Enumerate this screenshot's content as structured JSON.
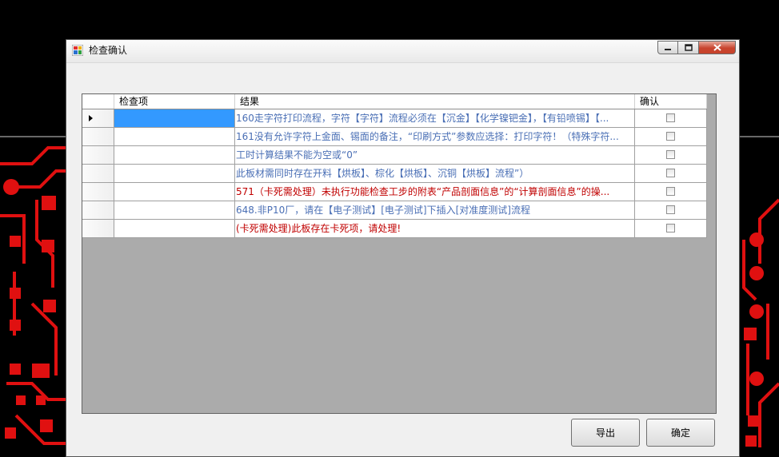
{
  "window": {
    "title": "检查确认",
    "controls": {
      "minimize": "minimize",
      "maximize": "maximize",
      "close": "close"
    }
  },
  "grid": {
    "columns": [
      "检查项",
      "结果",
      "确认"
    ],
    "rows": [
      {
        "item": "",
        "result": "160走字符打印流程，字符【字符】流程必须在【沉金】【化学镍钯金】，【有铅喷锡】【...",
        "confirmed": false,
        "selected": true,
        "color": "#4a6fb5"
      },
      {
        "item": "",
        "result": "161没有允许字符上金面、锡面的备注，“印刷方式”参数应选择：打印字符！（特殊字符...",
        "confirmed": false,
        "selected": false,
        "color": "#4a6fb5"
      },
      {
        "item": "",
        "result": "工时计算结果不能为空或“0”",
        "confirmed": false,
        "selected": false,
        "color": "#4a6fb5"
      },
      {
        "item": "",
        "result": "此板材需同时存在开料【烘板】、棕化【烘板】、沉铜【烘板】流程”）",
        "confirmed": false,
        "selected": false,
        "color": "#4a6fb5"
      },
      {
        "item": "",
        "result": "571（卡死需处理）未执行功能检查工步的附表“产品剖面信息”的“计算剖面信息”的操...",
        "confirmed": false,
        "selected": false,
        "color": "#c00000"
      },
      {
        "item": "",
        "result": "648.非P10厂，请在【电子测试】[电子测试]下插入[对准度测试]流程",
        "confirmed": false,
        "selected": false,
        "color": "#4a6fb5"
      },
      {
        "item": "",
        "result": "(卡死需处理)此板存在卡死项，请处理!",
        "confirmed": false,
        "selected": false,
        "color": "#c00000"
      }
    ]
  },
  "buttons": {
    "export": "导出",
    "ok": "确定"
  },
  "colors": {
    "accent_red": "#e01010",
    "selection": "#3399ff",
    "info_text": "#4a6fb5",
    "error_text": "#c00000"
  }
}
